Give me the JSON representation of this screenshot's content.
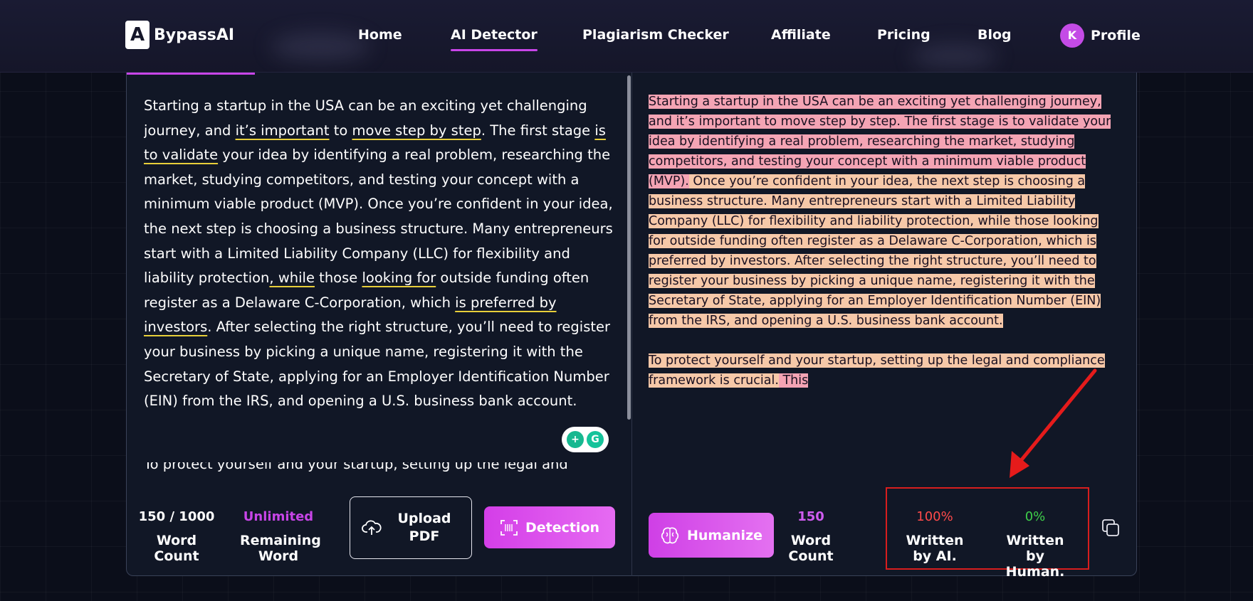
{
  "brand": {
    "name": "BypassAI",
    "logo_letter": "A"
  },
  "nav": {
    "items": [
      {
        "label": "Home",
        "active": false
      },
      {
        "label": "AI Detector",
        "active": true
      },
      {
        "label": "Plagiarism Checker",
        "active": false
      },
      {
        "label": "Affiliate",
        "active": false
      },
      {
        "label": "Pricing",
        "active": false
      },
      {
        "label": "Blog",
        "active": false
      }
    ],
    "profile": {
      "initial": "K",
      "label": "Profile"
    }
  },
  "input": {
    "text_segments": [
      {
        "text": "Starting a startup in the USA can be an exciting yet challenging journey, and ",
        "underline": false
      },
      {
        "text": "it’s important",
        "underline": true
      },
      {
        "text": " to ",
        "underline": false
      },
      {
        "text": "move step by step",
        "underline": true
      },
      {
        "text": ". The first stage ",
        "underline": false
      },
      {
        "text": "is to validate",
        "underline": true
      },
      {
        "text": " your idea by identifying a real problem, researching the market, studying competitors, and testing your concept with a minimum viable product (MVP). Once you’re confident in your idea, the next step is choosing a business structure. Many entrepreneurs start with a Limited Liability Company (LLC) for flexibility and liability protection",
        "underline": false
      },
      {
        "text": ", while",
        "underline": true
      },
      {
        "text": " those ",
        "underline": false
      },
      {
        "text": "looking for",
        "underline": true
      },
      {
        "text": " outside funding often register as a Delaware C-Corporation, which ",
        "underline": false
      },
      {
        "text": "is preferred by investors",
        "underline": true
      },
      {
        "text": ". After selecting the right structure, you’ll need to register your business by picking a unique name, registering it with the Secretary of State, applying for an Employer Identification Number (EIN) from the IRS, and opening a U.S. business bank account.",
        "underline": false
      }
    ],
    "partial_next_line": "To protect yourself and your startup, setting up the legal and"
  },
  "input_stats": {
    "word_count_value": "150 / 1000",
    "word_count_label": "Word Count",
    "remaining_value": "Unlimited",
    "remaining_label": "Remaining Word",
    "upload_label": "Upload PDF",
    "detect_label": "Detection"
  },
  "output": {
    "paragraphs": [
      [
        {
          "text": "Starting a startup in the USA can be an exciting yet challenging journey, and it’s important to move step by step.",
          "hl": "pink"
        },
        {
          "text": " The first stage is to validate your idea by identifying a real problem, researching the market, studying competitors, and testing your concept with a minimum viable product (MVP).",
          "hl": "pink"
        },
        {
          "text": " Once you’re confident in your idea, the next step is choosing a business structure.",
          "hl": "peach"
        },
        {
          "text": " Many entrepreneurs start with a Limited Liability Company (LLC) for flexibility and liability protection, while those looking for outside funding often register as a Delaware C-Corporation, which is preferred by investors.",
          "hl": "peach"
        },
        {
          "text": " After selecting the right structure, you’ll need to register your business by picking a unique name, registering it with the Secretary of State, applying for an Employer Identification Number (EIN) from the IRS, and opening a U.S. business bank account.",
          "hl": "peach"
        }
      ],
      [
        {
          "text": "To protect yourself and your startup, setting up the legal and compliance framework is crucial.",
          "hl": "peach"
        },
        {
          "text": " This",
          "hl": "pink"
        }
      ]
    ]
  },
  "output_stats": {
    "humanize_label": "Humanize",
    "word_count_value": "150",
    "word_count_label": "Word Count",
    "ai_value": "100%",
    "ai_label": "Written by AI.",
    "human_value": "0%",
    "human_label": "Written by Human."
  },
  "colors": {
    "accent": "#c845e8",
    "ai_score": "#ff4a4a",
    "human_score": "#3ecf4a",
    "remaining": "#c845e8",
    "word_count_purple": "#cf5cf0",
    "highlight_pink": "#f4a4b4",
    "highlight_peach": "#f6c8a8",
    "annotation_red": "#d81e1e"
  },
  "icons": {
    "upload": "cloud-upload-icon",
    "detect": "scan-icon",
    "humanize": "brain-icon",
    "copy": "copy-icon",
    "grammarly": "grammarly-icon"
  }
}
